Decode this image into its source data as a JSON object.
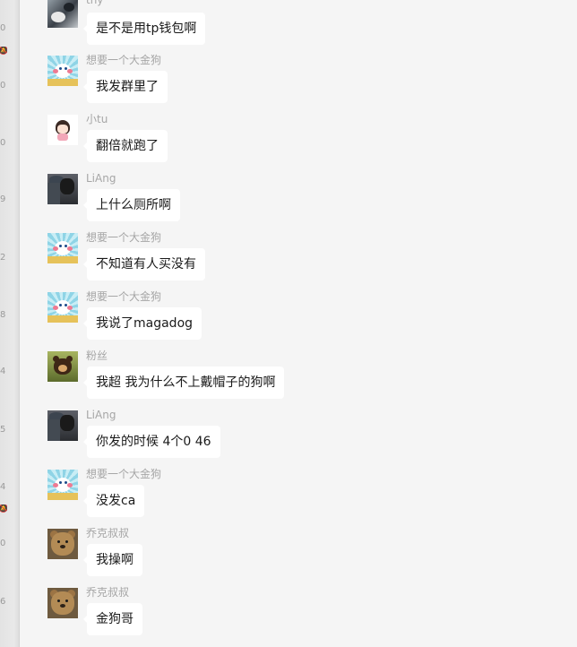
{
  "side_marks": [
    "0",
    "0",
    "0",
    "9",
    "2",
    "8",
    "4",
    "5",
    "4",
    "0",
    "6"
  ],
  "messages": [
    {
      "sender": "tny",
      "text": "是不是用tp钱包啊",
      "avatar": "cat-avatar"
    },
    {
      "sender": "想要一个大金狗",
      "text": "我发群里了",
      "avatar": "cartoon-dog-avatar"
    },
    {
      "sender": "小tu",
      "text": "翻倍就跑了",
      "avatar": "girl-avatar"
    },
    {
      "sender": "LiAng",
      "text": "上什么厕所啊",
      "avatar": "man-with-dog-avatar"
    },
    {
      "sender": "想要一个大金狗",
      "text": "不知道有人买没有",
      "avatar": "cartoon-dog-avatar"
    },
    {
      "sender": "想要一个大金狗",
      "text": "我说了magadog",
      "avatar": "cartoon-dog-avatar"
    },
    {
      "sender": "粉丝",
      "text": "我超 我为什么不上戴帽子的狗啊",
      "avatar": "bear-avatar"
    },
    {
      "sender": "LiAng",
      "text": "你发的时候 4个0 46",
      "avatar": "man-with-dog-avatar"
    },
    {
      "sender": "想要一个大金狗",
      "text": "没发ca",
      "avatar": "cartoon-dog-avatar"
    },
    {
      "sender": "乔克叔叔",
      "text": "我操啊",
      "avatar": "teddy-bear-avatar"
    },
    {
      "sender": "乔克叔叔",
      "text": "金狗哥",
      "avatar": "teddy-bear-avatar"
    }
  ],
  "colors": {
    "background": "#f5f5f5",
    "bubble": "#ffffff",
    "sender_text": "#a6a6a6",
    "message_text": "#1a1a1a"
  }
}
